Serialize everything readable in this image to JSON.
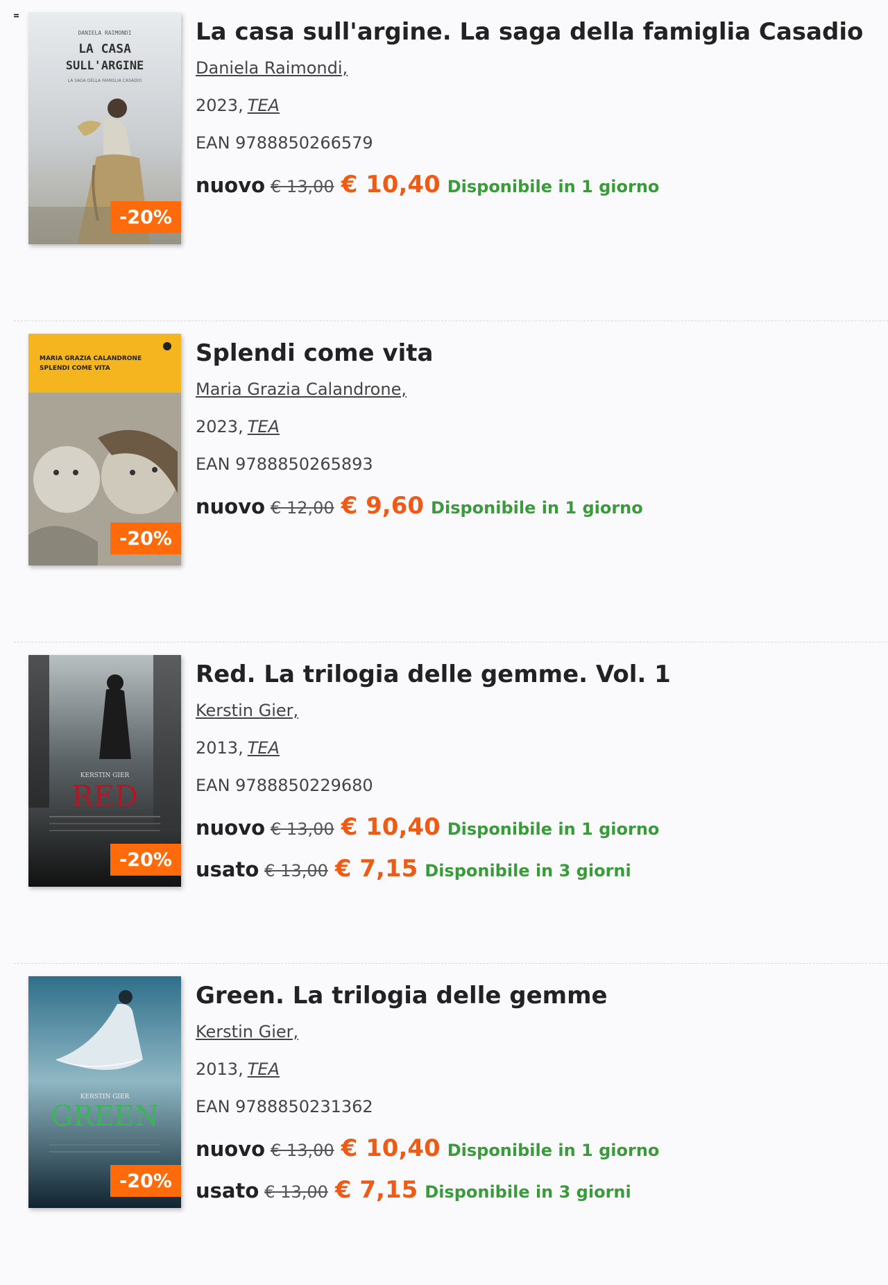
{
  "books": [
    {
      "title": "La casa sull'argine. La saga della famiglia Casadio",
      "author": "Daniela Raimondi,",
      "year": "2023,",
      "publisher": "TEA",
      "ean": "EAN 9788850266579",
      "badge": "-20%",
      "cover_texts": [
        "DANIELA RAIMONDI",
        "LA CASA",
        "SULL'ARGINE",
        "LA SAGA DELLA FAMIGLIA CASADIO"
      ],
      "offers": [
        {
          "cond": "nuovo",
          "old": "€ 13,00",
          "price": "€ 10,40",
          "avail": "Disponibile in 1 giorno"
        }
      ]
    },
    {
      "title": "Splendi come vita",
      "author": "Maria Grazia Calandrone,",
      "year": "2023,",
      "publisher": "TEA",
      "ean": "EAN 9788850265893",
      "badge": "-20%",
      "cover_texts": [
        "MARIA GRAZIA CALANDRONE",
        "SPLENDI COME VITA"
      ],
      "offers": [
        {
          "cond": "nuovo",
          "old": "€ 12,00",
          "price": "€ 9,60",
          "avail": "Disponibile in 1 giorno"
        }
      ]
    },
    {
      "title": "Red. La trilogia delle gemme. Vol. 1",
      "author": "Kerstin Gier,",
      "year": "2013,",
      "publisher": "TEA",
      "ean": "EAN 9788850229680",
      "badge": "-20%",
      "cover_texts": [
        "KERSTIN GIER",
        "RED"
      ],
      "offers": [
        {
          "cond": "nuovo",
          "old": "€ 13,00",
          "price": "€ 10,40",
          "avail": "Disponibile in 1 giorno"
        },
        {
          "cond": "usato",
          "old": "€ 13,00",
          "price": "€ 7,15",
          "avail": "Disponibile in 3 giorni"
        }
      ]
    },
    {
      "title": "Green. La trilogia delle gemme",
      "author": "Kerstin Gier,",
      "year": "2013,",
      "publisher": "TEA",
      "ean": "EAN 9788850231362",
      "badge": "-20%",
      "cover_texts": [
        "KERSTIN GIER",
        "GREEN"
      ],
      "offers": [
        {
          "cond": "nuovo",
          "old": "€ 13,00",
          "price": "€ 10,40",
          "avail": "Disponibile in 1 giorno"
        },
        {
          "cond": "usato",
          "old": "€ 13,00",
          "price": "€ 7,15",
          "avail": "Disponibile in 3 giorni"
        }
      ]
    }
  ]
}
